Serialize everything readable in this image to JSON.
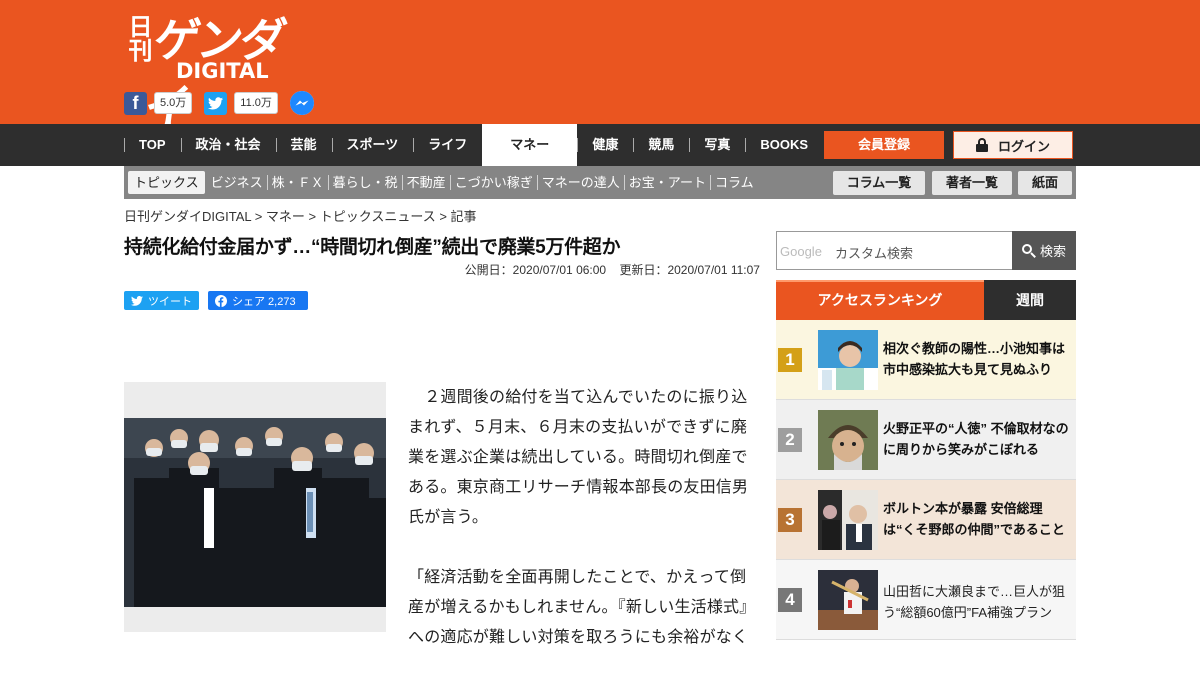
{
  "brand": {
    "logo_kanji": "日刊",
    "logo_main": "ゲンダイ",
    "logo_sub": "DIGITAL",
    "accent_color": "#ea5520"
  },
  "social": {
    "facebook_count": "5.0万",
    "twitter_count": "11.0万",
    "facebook_glyph": "f",
    "twitter_glyph": "t"
  },
  "nav": {
    "items": [
      "TOP",
      "政治・社会",
      "芸能",
      "スポーツ",
      "ライフ",
      "マネー",
      "健康",
      "競馬",
      "写真",
      "BOOKS"
    ],
    "active": "マネー",
    "register_label": "会員登録",
    "login_label": "ログイン"
  },
  "subnav": {
    "items": [
      "トピックス",
      "ビジネス",
      "株・ＦＸ",
      "暮らし・税",
      "不動産",
      "こづかい稼ぎ",
      "マネーの達人",
      "お宝・アート",
      "コラム"
    ],
    "buttons": [
      "コラム一覧",
      "著者一覧",
      "紙面"
    ]
  },
  "breadcrumb": "日刊ゲンダイDIGITAL > マネー > トピックスニュース > 記事",
  "article": {
    "title": "持続化給付金届かず…“時間切れ倒産”続出で廃業5万件超か",
    "published": "公開日：2020/07/01 06:00",
    "updated": "更新日：2020/07/01 11:07",
    "tweet_label": "ツイート",
    "share_label": "シェア 2,273",
    "paragraphs": [
      "２週間後の給付を当て込んでいたのに振り込まれず、５月末、６月末の支払いができずに廃業を選ぶ企業は続出している。時間切れ倒産である。東京商工リサーチ情報本部長の友田信男氏が言う。",
      "「経済活動を全面再開したことで、かえって倒産が増えるかもしれません。『新しい生活様式』への適応が難しい対策を取ろうにも余裕がなく"
    ]
  },
  "search": {
    "logo": "Google",
    "placeholder": "カスタム検索",
    "button_label": "検索"
  },
  "ranking": {
    "tab_access": "アクセスランキング",
    "tab_weekly": "週間",
    "items": [
      {
        "rank": "1",
        "text": "相次ぐ教師の陽性…小池知事は市中感染拡大も見て見ぬふり",
        "color": "#d4a017"
      },
      {
        "rank": "2",
        "text": "火野正平の“人徳” 不倫取材なのに周りから笑みがこぼれる",
        "color": "#9e9e9e"
      },
      {
        "rank": "3",
        "text": "ボルトン本が暴露 安倍総理は“くそ野郎の仲間”であること",
        "color": "#b87333"
      },
      {
        "rank": "4",
        "text": "山田哲に大瀬良まで…巨人が狙う“総額60億円”FA補強プラン",
        "color": "#777777"
      }
    ]
  }
}
